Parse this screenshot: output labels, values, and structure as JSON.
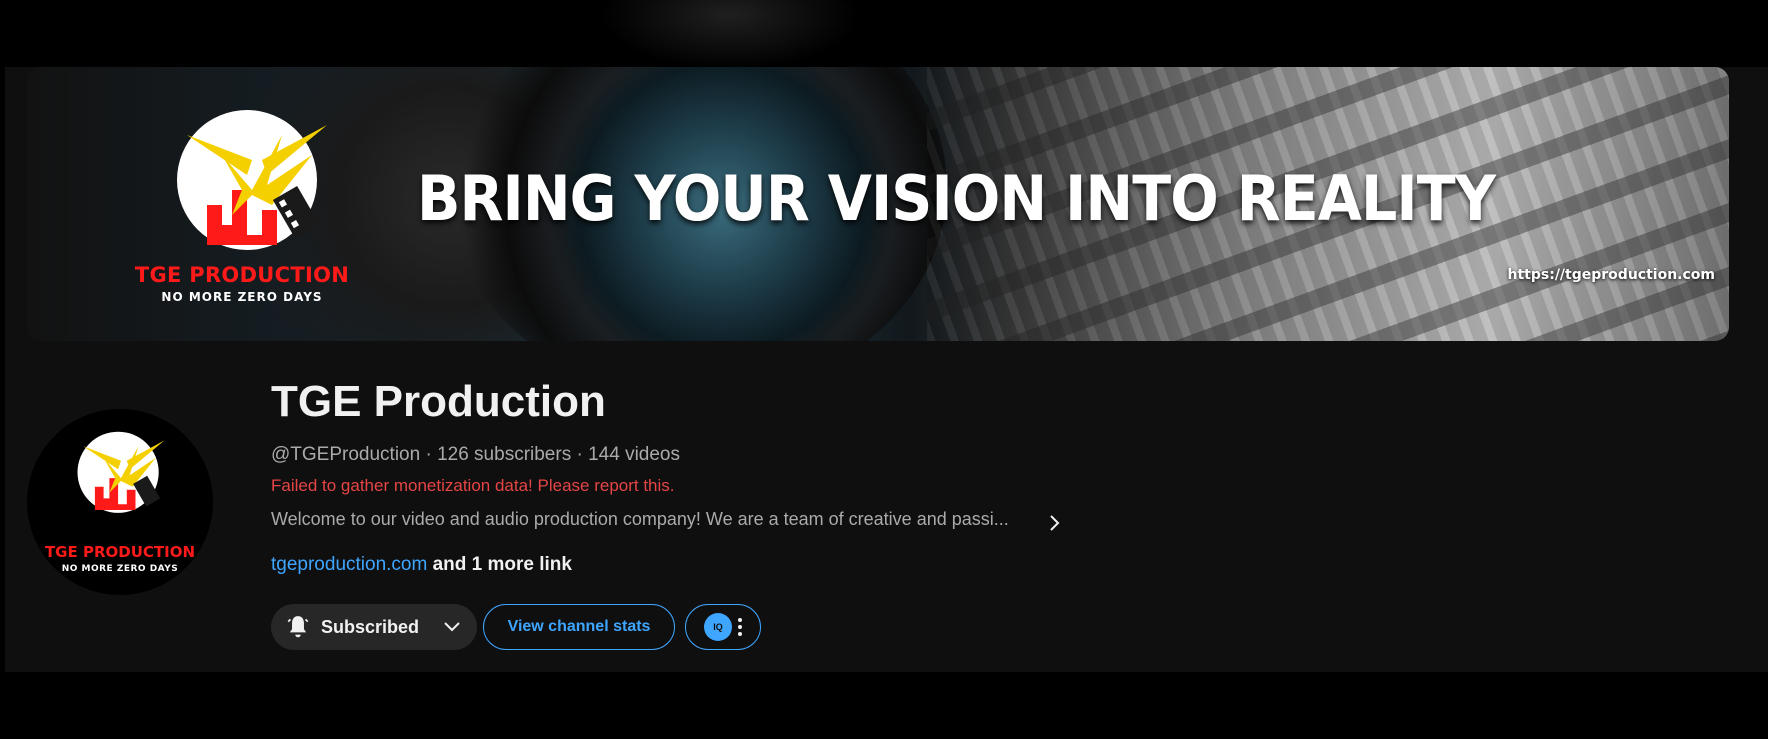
{
  "banner": {
    "logo_name": "TGE PRODUCTION",
    "logo_tagline": "NO MORE ZERO DAYS",
    "headline": "BRING YOUR VISION INTO REALITY",
    "url": "https://tgeproduction.com"
  },
  "avatar": {
    "logo_name": "TGE PRODUCTION",
    "logo_tagline": "NO MORE ZERO DAYS"
  },
  "channel": {
    "name": "TGE Production",
    "handle": "@TGEProduction",
    "subscribers": "126 subscribers",
    "videos": "144 videos",
    "separator": " · ",
    "error_message": "Failed to gather monetization data! Please report this.",
    "description": "Welcome to our video and audio production company! We are a team of creative and passi...",
    "link_text": "tgeproduction.com",
    "more_links": "and 1 more link"
  },
  "actions": {
    "subscribe_label": "Subscribed",
    "stats_label": "View channel stats",
    "extension_label": "IQ"
  },
  "colors": {
    "accent": "#3ea6ff",
    "error": "#e64545",
    "logo_red": "#ff1a1a",
    "logo_yellow": "#f5d000"
  },
  "icons": {
    "bell": "bell-icon",
    "chevron_down": "chevron-down-icon",
    "chevron_right": "chevron-right-icon",
    "more": "more-vert-icon"
  }
}
